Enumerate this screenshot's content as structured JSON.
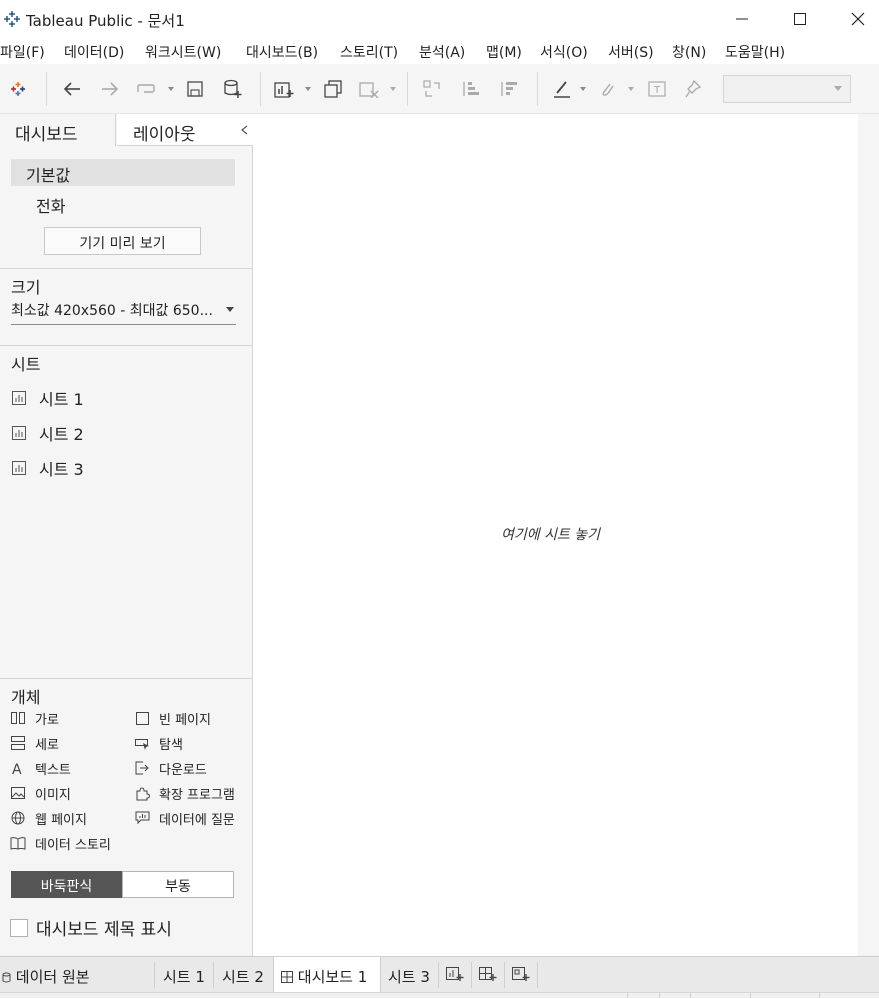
{
  "window": {
    "title": "Tableau Public - 문서1"
  },
  "menu": [
    "파일(F)",
    "데이터(D)",
    "워크시트(W)",
    "대시보드(B)",
    "스토리(T)",
    "분석(A)",
    "맵(M)",
    "서식(O)",
    "서버(S)",
    "창(N)",
    "도움말(H)"
  ],
  "panel": {
    "tab_dashboard": "대시보드",
    "tab_layout": "레이아웃",
    "device_default": "기본값",
    "device_phone": "전화",
    "preview_button": "기기 미리 보기",
    "size_title": "크기",
    "size_value": "최소값 420x560 - 최대값 650...",
    "sheets_title": "시트",
    "sheets": [
      "시트 1",
      "시트 2",
      "시트 3"
    ],
    "objects_title": "개체",
    "objects": {
      "horizontal": "가로",
      "blank": "빈 페이지",
      "vertical": "세로",
      "navigation": "탐색",
      "text": "텍스트",
      "download": "다운로드",
      "image": "이미지",
      "extension": "확장 프로그램",
      "webpage": "웹 페이지",
      "ask_data": "데이터에 질문",
      "data_story": "데이터 스토리"
    },
    "tiled": "바둑판식",
    "floating": "부동",
    "show_title": "대시보드 제목 표시",
    "show_title_checked": false
  },
  "canvas": {
    "drop_hint": "여기에 시트 놓기"
  },
  "bottom_tabs": {
    "data_source": "데이터 원본",
    "sheet1": "시트 1",
    "sheet2": "시트 2",
    "dashboard1": "대시보드 1",
    "sheet3": "시트 3",
    "active": "대시보드 1"
  },
  "colors": {
    "panel_bg": "#f5f5f5",
    "selected_bg": "#e1e1e1",
    "tiled_active": "#555555"
  }
}
